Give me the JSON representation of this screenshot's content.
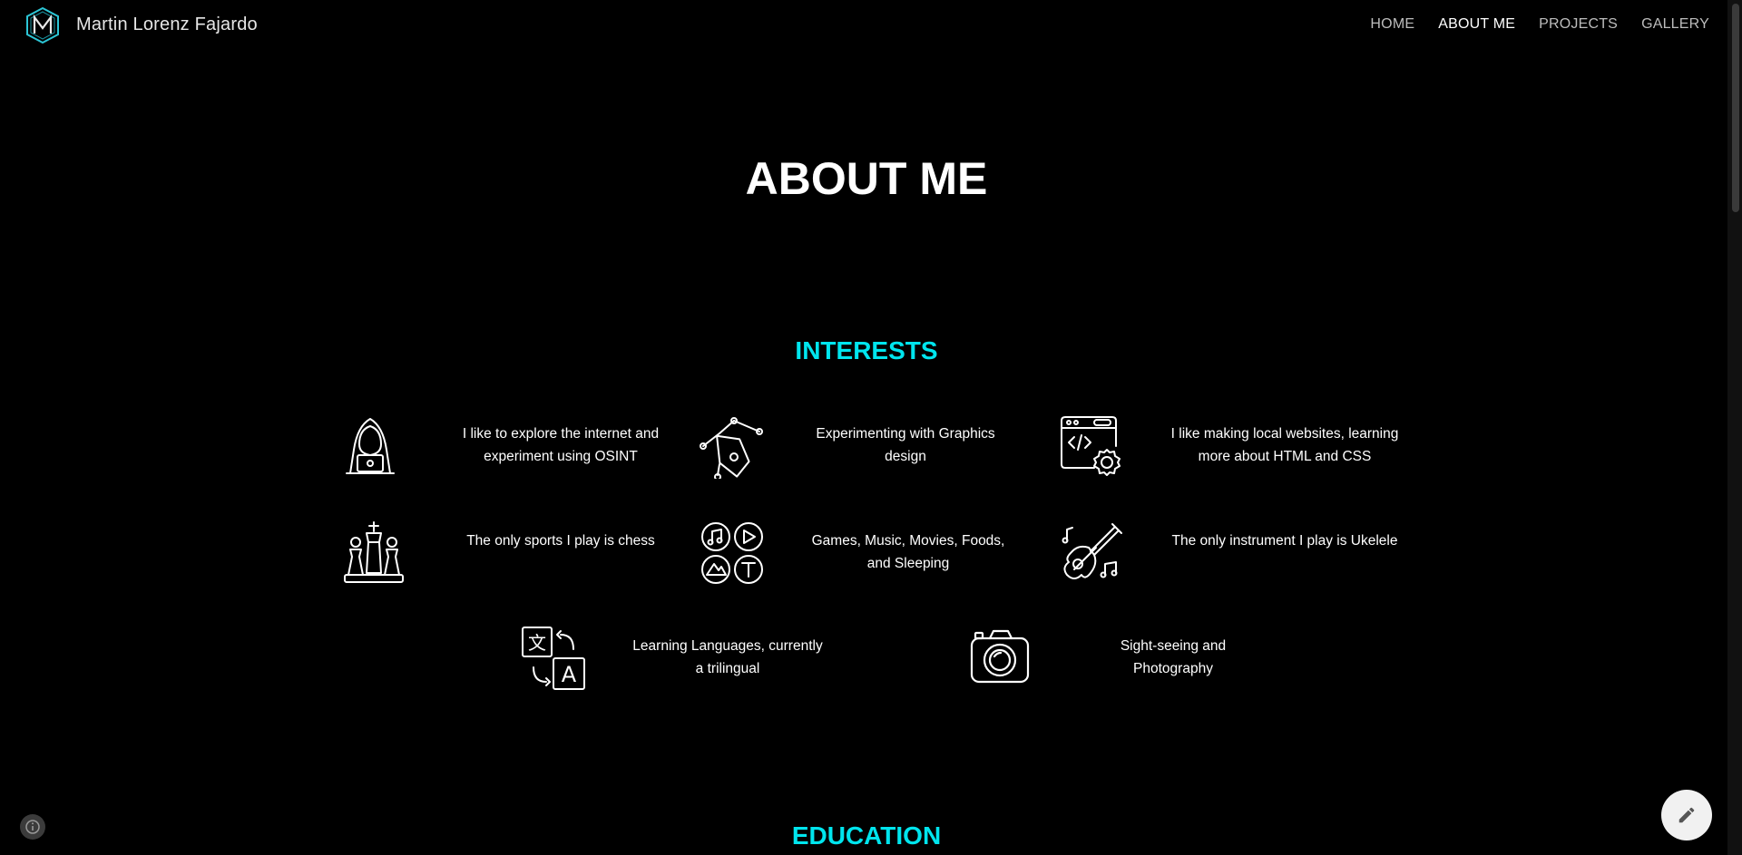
{
  "header": {
    "site_title": "Martin Lorenz Fajardo",
    "nav": [
      {
        "label": "HOME",
        "active": false
      },
      {
        "label": "ABOUT ME",
        "active": true
      },
      {
        "label": "PROJECTS",
        "active": false
      },
      {
        "label": "GALLERY",
        "active": false
      }
    ]
  },
  "page": {
    "title": "ABOUT ME",
    "interests_heading": "INTERESTS",
    "education_heading": "EDUCATION"
  },
  "interests": [
    {
      "icon": "hacker-icon",
      "text": "I like to explore the internet and experiment using OSINT"
    },
    {
      "icon": "pen-tool-icon",
      "text": "Experimenting with Graphics design"
    },
    {
      "icon": "web-settings-icon",
      "text": "I like making local websites, learning more about HTML and CSS"
    },
    {
      "icon": "chess-icon",
      "text": "The only sports I play is chess"
    },
    {
      "icon": "media-icon",
      "text": "Games, Music, Movies, Foods, and Sleeping"
    },
    {
      "icon": "ukulele-icon",
      "text": "The only instrument I play is Ukelele"
    },
    {
      "icon": "translate-icon",
      "text": "Learning Languages, currently a trilingual"
    },
    {
      "icon": "camera-icon",
      "text": "Sight-seeing and Photography"
    }
  ],
  "colors": {
    "accent": "#00e5ee",
    "background": "#000000",
    "text": "#ffffff"
  }
}
